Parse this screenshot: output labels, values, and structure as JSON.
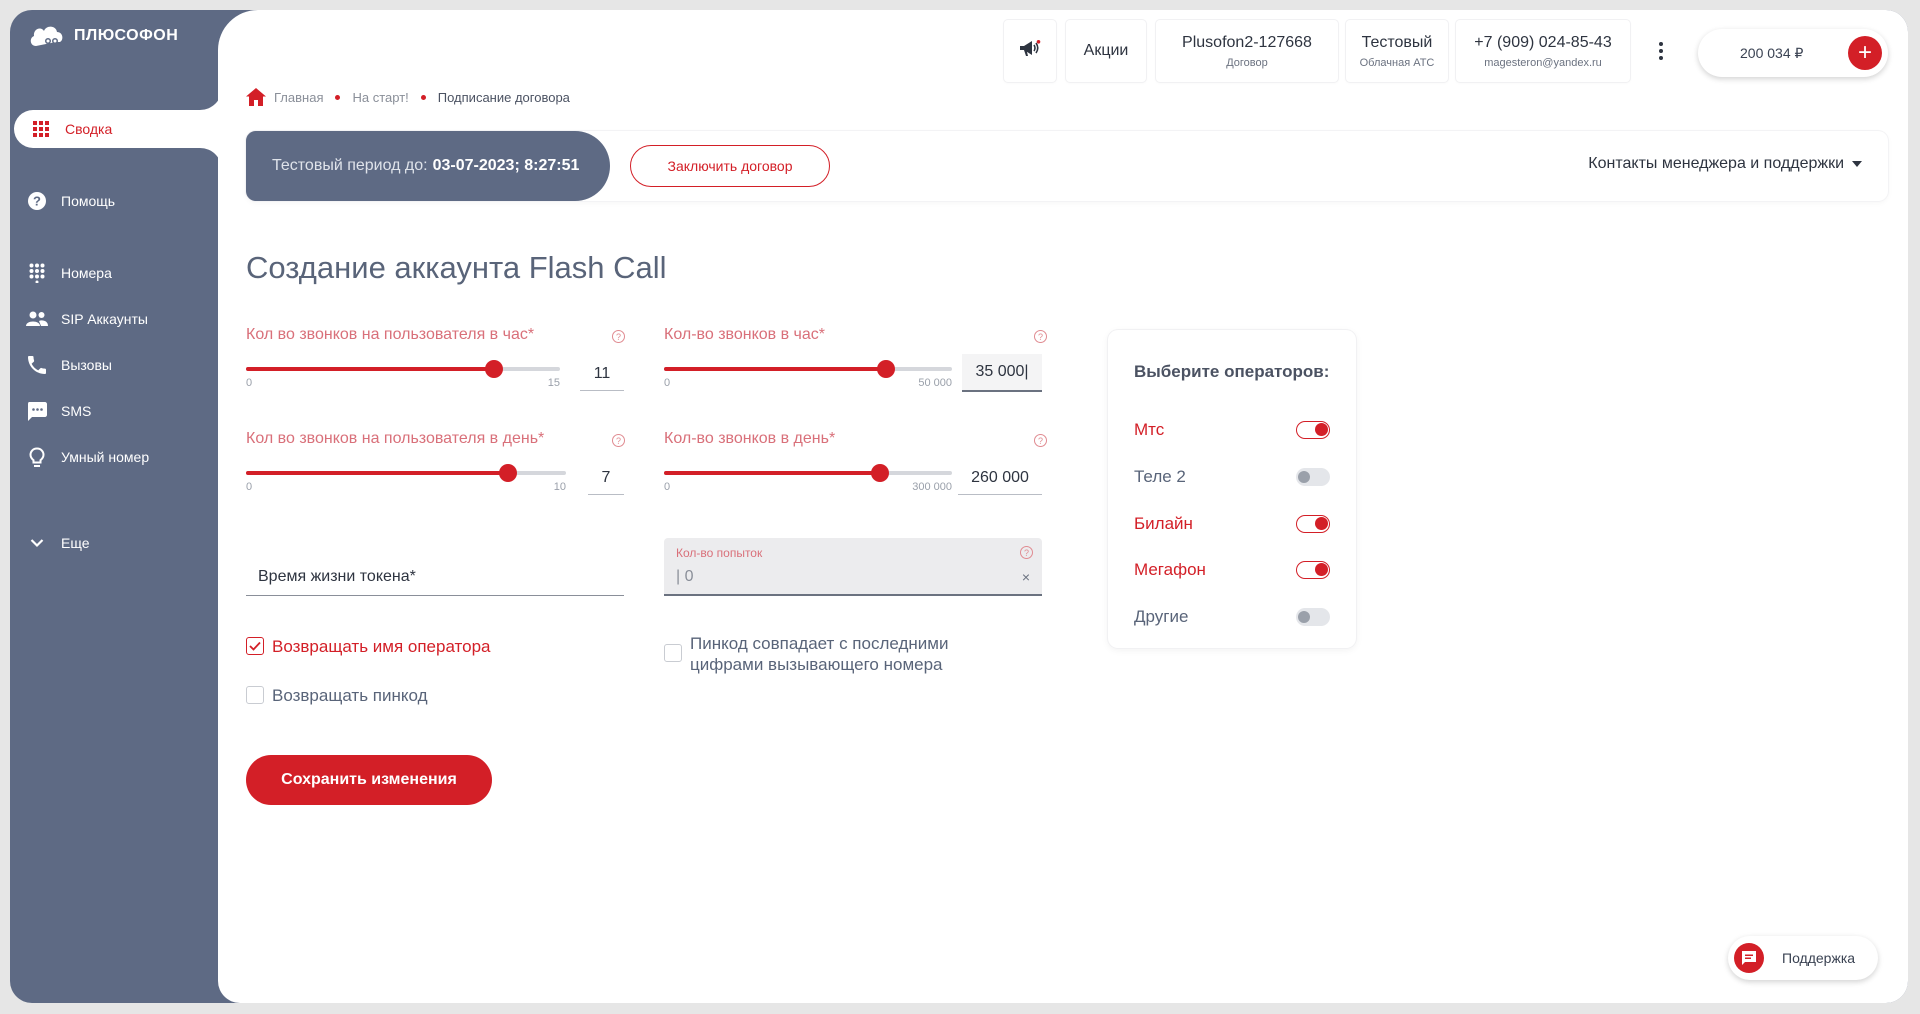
{
  "sidebar": {
    "logo_text": "ПЛЮСОФОН",
    "items": [
      {
        "label": "Сводка",
        "icon": "grid-icon"
      },
      {
        "label": "Помощь",
        "icon": "help-circle-icon"
      },
      {
        "label": "Номера",
        "icon": "dialpad-icon"
      },
      {
        "label": "SIP Аккаунты",
        "icon": "people-icon"
      },
      {
        "label": "Вызовы",
        "icon": "phone-icon"
      },
      {
        "label": "SMS",
        "icon": "sms-icon"
      },
      {
        "label": "Умный номер",
        "icon": "lightbulb-icon"
      },
      {
        "label": "Еще",
        "icon": "chevron-down-icon"
      }
    ]
  },
  "header": {
    "promo_label": "Акции",
    "contract": {
      "title": "Plusofon2-127668",
      "sub": "Договор"
    },
    "plan": {
      "title": "Тестовый",
      "sub": "Облачная АТС"
    },
    "user": {
      "phone": "+7 (909) 024-85-43",
      "email": "magesteron@yandex.ru"
    },
    "balance": "200 034 ₽"
  },
  "breadcrumb": [
    "Главная",
    "На старт!",
    "Подписание договора"
  ],
  "trial": {
    "prefix": "Тестовый период до:",
    "date": "03-07-2023; 8:27:51",
    "contract_button": "Заключить договор",
    "contacts": "Контакты менеджера и поддержки"
  },
  "page_title": "Создание аккаунта Flash Call",
  "form": {
    "per_user_hour": {
      "label": "Кол во звонков на пользователя в час*",
      "min": "0",
      "max": "15",
      "value": "11",
      "fraction": 0.79
    },
    "per_hour": {
      "label": "Кол-во звонков в час*",
      "min": "0",
      "max": "50 000",
      "value": "35 000|",
      "fraction": 0.77
    },
    "per_user_day": {
      "label": "Кол во звонков на пользователя в день*",
      "min": "0",
      "max": "10",
      "value": "7",
      "fraction": 0.82
    },
    "per_day": {
      "label": "Кол-во звонков в день*",
      "min": "0",
      "max": "300 000",
      "value": "260 000",
      "fraction": 0.75
    },
    "token_lifetime": {
      "label": "Время жизни токена*"
    },
    "attempts": {
      "label": "Кол-во попыток",
      "value": "| 0"
    },
    "return_operator": {
      "label": "Возвращать имя оператора",
      "checked": true
    },
    "return_pin": {
      "label": "Возвращать пинкод",
      "checked": false
    },
    "pin_match": {
      "label_line1": "Пинкод совпадает с последними",
      "label_line2": "цифрами вызывающего номера",
      "checked": false
    },
    "save_button": "Сохранить изменения"
  },
  "operators": {
    "title": "Выберите операторов:",
    "items": [
      {
        "name": "Мтс",
        "on": true
      },
      {
        "name": "Теле 2",
        "on": false
      },
      {
        "name": "Билайн",
        "on": true
      },
      {
        "name": "Мегафон",
        "on": true
      },
      {
        "name": "Другие",
        "on": false
      }
    ]
  },
  "support_label": "Поддержка",
  "colors": {
    "accent": "#d31f27",
    "sidebar": "#5e6a84"
  }
}
